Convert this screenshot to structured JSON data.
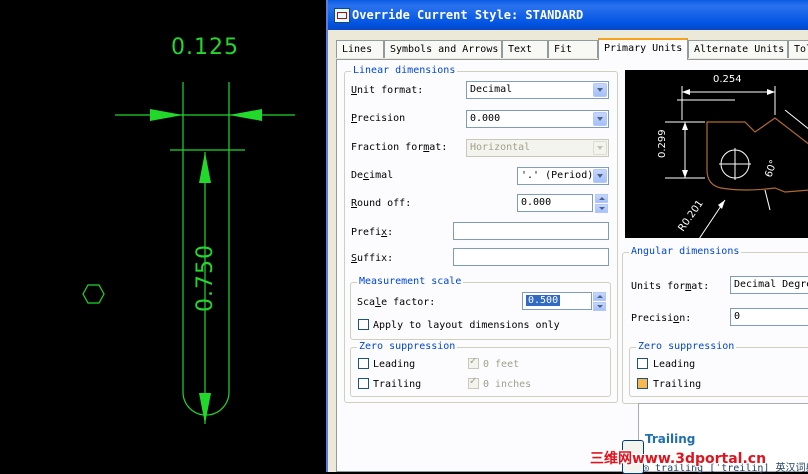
{
  "cad": {
    "top_dimension": "0.125",
    "vertical_dimension": "0.750"
  },
  "dialog": {
    "title": "Override Current Style: STANDARD",
    "tabs": [
      "Lines",
      "Symbols and Arrows",
      "Text",
      "Fit",
      "Primary Units",
      "Alternate Units",
      "Tol"
    ],
    "active_tab": "Primary Units",
    "linear": {
      "group_label": "Linear dimensions",
      "unit_format_label": "Unit format:",
      "unit_format_value": "Decimal",
      "precision_label": "Precision",
      "precision_value": "0.000",
      "fraction_format_label": "Fraction format:",
      "fraction_format_value": "Horizontal",
      "decimal_label": "Decimal",
      "decimal_value": "'.' (Period)",
      "round_off_label": "Round off:",
      "round_off_value": "0.000",
      "prefix_label": "Prefix:",
      "prefix_value": "",
      "suffix_label": "Suffix:",
      "suffix_value": ""
    },
    "measurement": {
      "group_label": "Measurement scale",
      "scale_factor_label": "Scale factor:",
      "scale_factor_value": "0.500",
      "apply_layout_label": "Apply to layout dimensions only"
    },
    "zero_suppression_left": {
      "group_label": "Zero suppression",
      "leading": "Leading",
      "trailing": "Trailing",
      "feet": "0 feet",
      "inches": "0 inches"
    },
    "preview": {
      "dim_top": "0.254",
      "dim_left": "0.299",
      "dim_radius": "R0.201",
      "dim_angle": "60°"
    },
    "angular": {
      "group_label": "Angular dimensions",
      "units_format_label": "Units format:",
      "units_format_value": "Decimal Degrees",
      "precision_label": "Precision:",
      "precision_value": "0"
    },
    "zero_suppression_right": {
      "group_label": "Zero suppression",
      "leading": "Leading",
      "trailing": "Trailing"
    },
    "tooltip": {
      "title": "Trailing",
      "subtitle": "◎ trailing [ˈtreiliŋ] 英汉词典"
    }
  },
  "watermark": "三维网www.3dportal.cn"
}
